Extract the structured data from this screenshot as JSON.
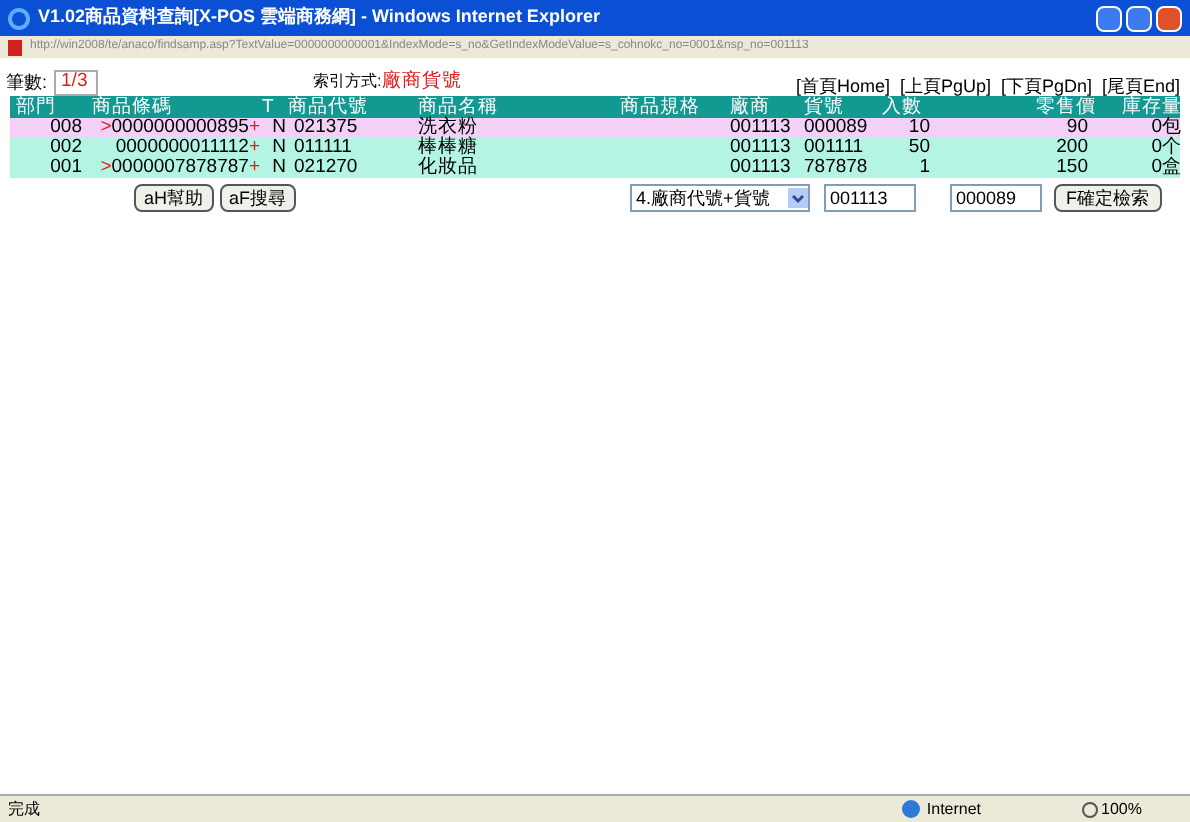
{
  "window": {
    "title": "V1.02商品資料查詢[X-POS 雲端商務網] - Windows Internet Explorer",
    "address": "http://win2008/te/anaco/findsamp.asp?TextValue=0000000000001&IndexMode=s_no&GetIndexModeValue=s_cohnokc_no=0001&nsp_no=001113"
  },
  "record_count": {
    "label": "筆數:",
    "value": "1/3"
  },
  "index_mode": {
    "label": "索引方式:",
    "value": "廠商貨號"
  },
  "pager": [
    "[首頁Home]",
    "[上頁PgUp]",
    "[下頁PgDn]",
    "[尾頁End]"
  ],
  "table": {
    "columns": [
      "部門",
      "商品條碼",
      "T",
      "商品代號",
      "商品名稱",
      "商品規格",
      "廠商",
      "貨號",
      "入數",
      "零售價",
      "庫存量"
    ],
    "rows": [
      {
        "selected": true,
        "dept": "008",
        "marker": ">",
        "barcode": "0000000000895",
        "plus": "+",
        "t": "N",
        "code": "021375",
        "name": "洗衣粉",
        "vendor": "001113",
        "item_no": "000089",
        "pack": "10",
        "price": "90",
        "stock": "0包"
      },
      {
        "selected": false,
        "dept": "002",
        "barcode": "0000000011112",
        "plus": "+",
        "t": "N",
        "code": "011111",
        "name": "棒棒糖",
        "vendor": "001113",
        "item_no": "001111",
        "pack": "50",
        "price": "200",
        "stock": "0个"
      },
      {
        "selected": false,
        "dept": "001",
        "marker": ">",
        "barcode": "0000007878787",
        "plus": "+",
        "t": "N",
        "code": "021270",
        "name": "化妝品",
        "vendor": "001113",
        "item_no": "787878",
        "pack": "1",
        "price": "150",
        "stock": "0盒"
      }
    ]
  },
  "buttons": [
    "aH幫助",
    "aF搜尋"
  ],
  "search": {
    "mode": "4.廠商代號+貨號",
    "vendor": "001113",
    "item_no": "000089",
    "submit": "F確定檢索"
  },
  "status_bar": {
    "text": "完成",
    "zone": "Internet",
    "zoom": "100%"
  }
}
